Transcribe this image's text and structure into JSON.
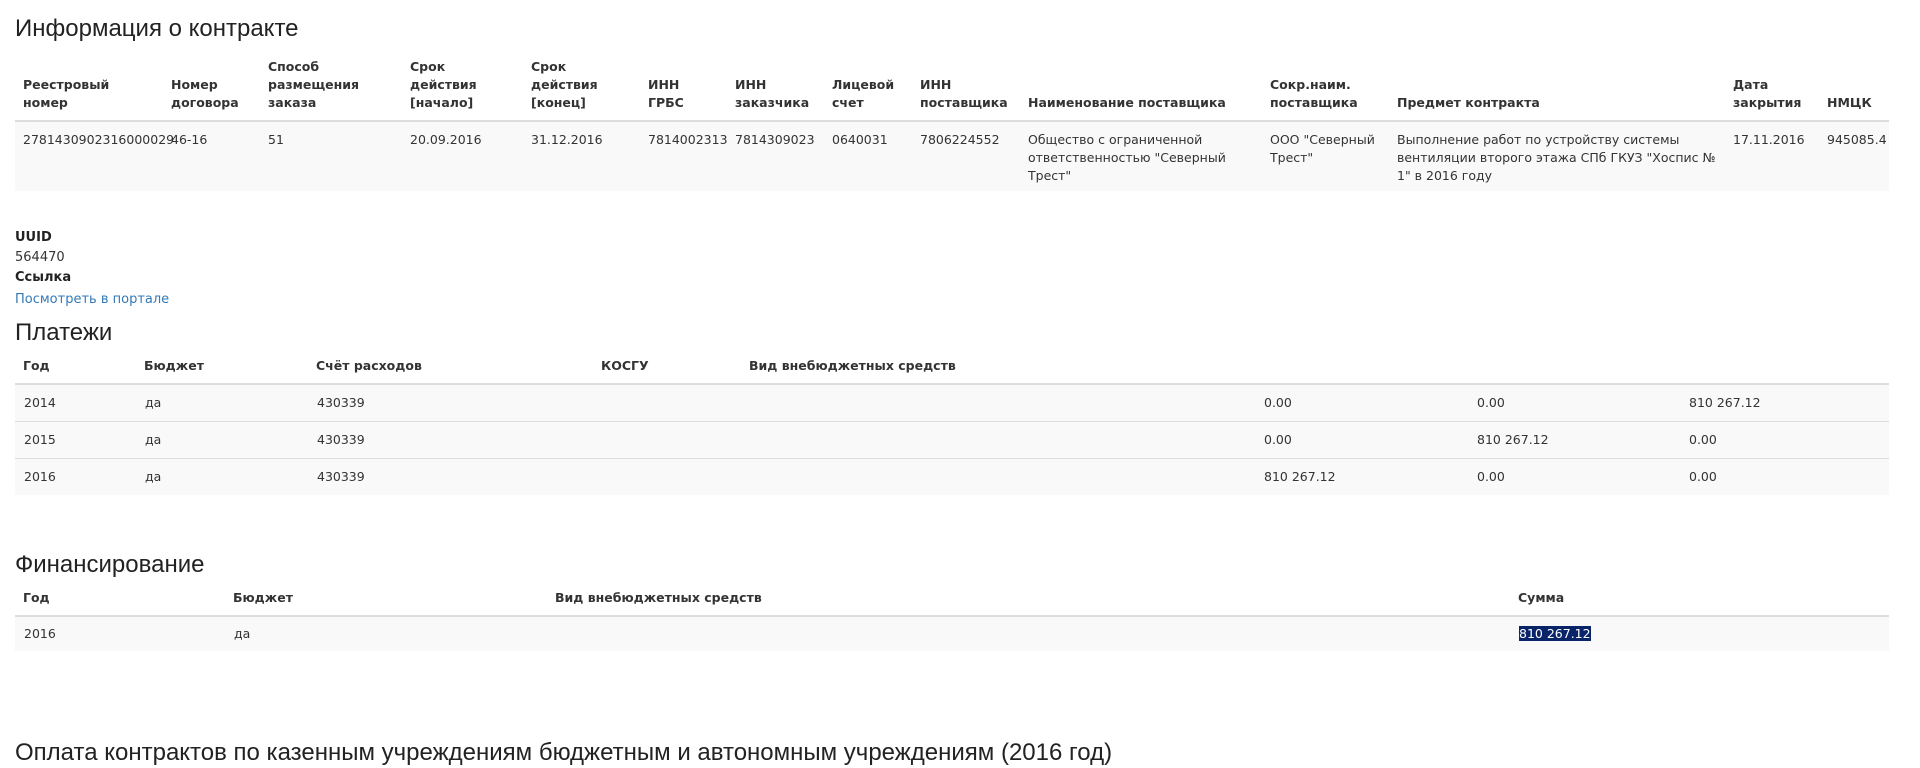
{
  "contract": {
    "title": "Информация о контракте",
    "headers": [
      "Реестровый номер",
      "Номер договора",
      "Способ размещения заказа",
      "Срок действия [начало]",
      "Срок действия [конец]",
      "ИНН ГРБС",
      "ИНН заказчика",
      "Лицевой счет",
      "ИНН поставщика",
      "Наименование поставщика",
      "Сокр.наим. поставщика",
      "Предмет контракта",
      "Дата закрытия",
      "НМЦК"
    ],
    "row": [
      "2781430902316000029",
      "46-16",
      "51",
      "20.09.2016",
      "31.12.2016",
      "7814002313",
      "7814309023",
      "0640031",
      "7806224552",
      "Общество с ограниченной ответственностью \"Северный Трест\"",
      "ООО \"Северный Трест\"",
      "Выполнение работ по устройству системы вентиляции второго этажа СПб ГКУЗ \"Хоспис № 1\" в 2016 году",
      "17.11.2016",
      "945085.4"
    ]
  },
  "meta": {
    "uuid_label": "UUID",
    "uuid_value": "564470",
    "link_label": "Ссылка",
    "link_text": "Посмотреть в портале"
  },
  "payments": {
    "title": "Платежи",
    "headers": [
      "Год",
      "Бюджет",
      "Счёт расходов",
      "КОСГУ",
      "Вид внебюджетных средств",
      "",
      "",
      ""
    ],
    "rows": [
      [
        "2014",
        "да",
        "430339",
        "",
        "",
        "0.00",
        "0.00",
        "810 267.12"
      ],
      [
        "2015",
        "да",
        "430339",
        "",
        "",
        "0.00",
        "810 267.12",
        "0.00"
      ],
      [
        "2016",
        "да",
        "430339",
        "",
        "",
        "810 267.12",
        "0.00",
        "0.00"
      ]
    ]
  },
  "financing": {
    "title": "Финансирование",
    "headers": [
      "Год",
      "Бюджет",
      "Вид внебюджетных средств",
      "Сумма"
    ],
    "rows": [
      [
        "2016",
        "да",
        "",
        "810 267.12"
      ]
    ]
  },
  "bottom_section": {
    "title": "Оплата контрактов по казенным учреждениям бюджетным и автономным учреждениям (2016 год)"
  }
}
